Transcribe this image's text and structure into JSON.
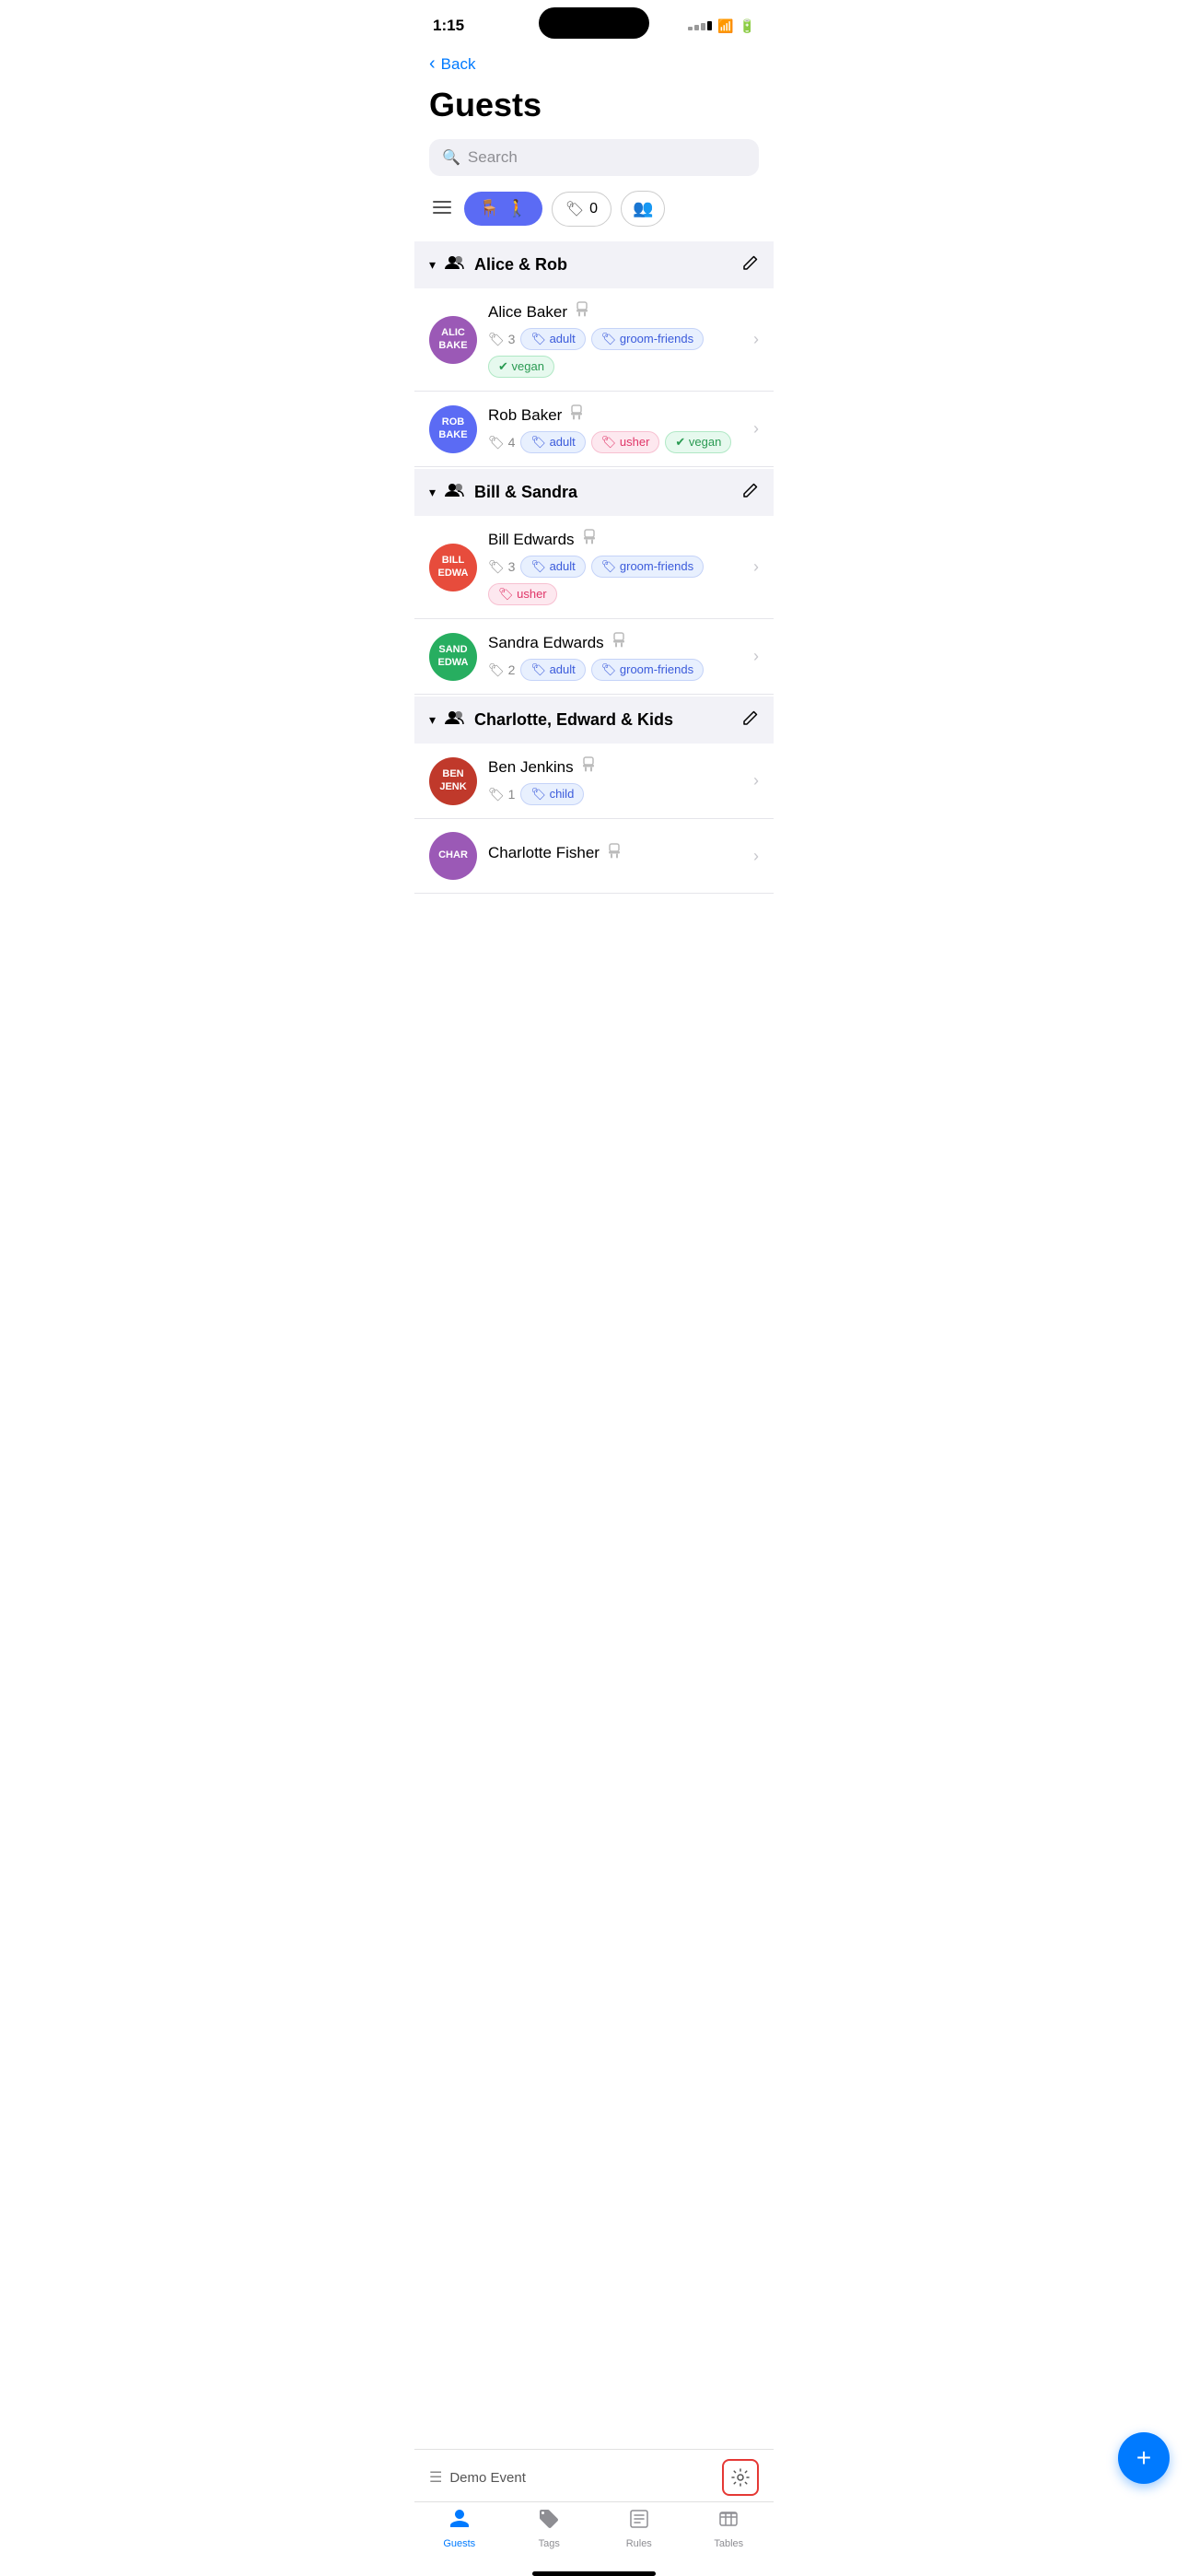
{
  "statusBar": {
    "time": "1:15"
  },
  "header": {
    "backLabel": "Back",
    "title": "Guests"
  },
  "search": {
    "placeholder": "Search"
  },
  "filters": {
    "tagsCount": "0"
  },
  "groups": [
    {
      "id": "alice-rob",
      "name": "Alice & Rob",
      "members": [
        {
          "id": "alice-baker",
          "initials": "ALIC\nBAKE",
          "avatarColor": "#9B59B6",
          "name": "Alice Baker",
          "tagCount": "3",
          "tags": [
            {
              "label": "adult",
              "type": "blue"
            },
            {
              "label": "groom-friends",
              "type": "blue"
            },
            {
              "label": "vegan",
              "type": "green"
            }
          ]
        },
        {
          "id": "rob-baker",
          "initials": "ROB\nBAKE",
          "avatarColor": "#5B6BF4",
          "name": "Rob Baker",
          "tagCount": "4",
          "tags": [
            {
              "label": "adult",
              "type": "blue"
            },
            {
              "label": "usher",
              "type": "pink"
            },
            {
              "label": "vegan",
              "type": "green"
            }
          ]
        }
      ]
    },
    {
      "id": "bill-sandra",
      "name": "Bill & Sandra",
      "members": [
        {
          "id": "bill-edwards",
          "initials": "BILL\nEDWA",
          "avatarColor": "#E74C3C",
          "name": "Bill Edwards",
          "tagCount": "3",
          "tags": [
            {
              "label": "adult",
              "type": "blue"
            },
            {
              "label": "groom-friends",
              "type": "blue"
            },
            {
              "label": "usher",
              "type": "pink"
            }
          ]
        },
        {
          "id": "sandra-edwards",
          "initials": "SAND\nEDWA",
          "avatarColor": "#27AE60",
          "name": "Sandra Edwards",
          "tagCount": "2",
          "tags": [
            {
              "label": "adult",
              "type": "blue"
            },
            {
              "label": "groom-friends",
              "type": "blue"
            }
          ]
        }
      ]
    },
    {
      "id": "charlotte-edward-kids",
      "name": "Charlotte, Edward & Kids",
      "members": [
        {
          "id": "ben-jenkins",
          "initials": "BEN\nJENK",
          "avatarColor": "#C0392B",
          "name": "Ben Jenkins",
          "tagCount": "1",
          "tags": [
            {
              "label": "child",
              "type": "blue"
            }
          ]
        },
        {
          "id": "charlotte-fisher",
          "initials": "CHAR",
          "avatarColor": "#9B59B6",
          "name": "Charlotte Fisher",
          "tagCount": "",
          "tags": []
        }
      ]
    }
  ],
  "fab": {
    "icon": "+"
  },
  "bottomBar": {
    "eventName": "Demo Event",
    "tabs": [
      {
        "id": "guests",
        "label": "Guests",
        "active": true
      },
      {
        "id": "tags",
        "label": "Tags",
        "active": false
      },
      {
        "id": "rules",
        "label": "Rules",
        "active": false
      },
      {
        "id": "tables",
        "label": "Tables",
        "active": false
      }
    ]
  }
}
